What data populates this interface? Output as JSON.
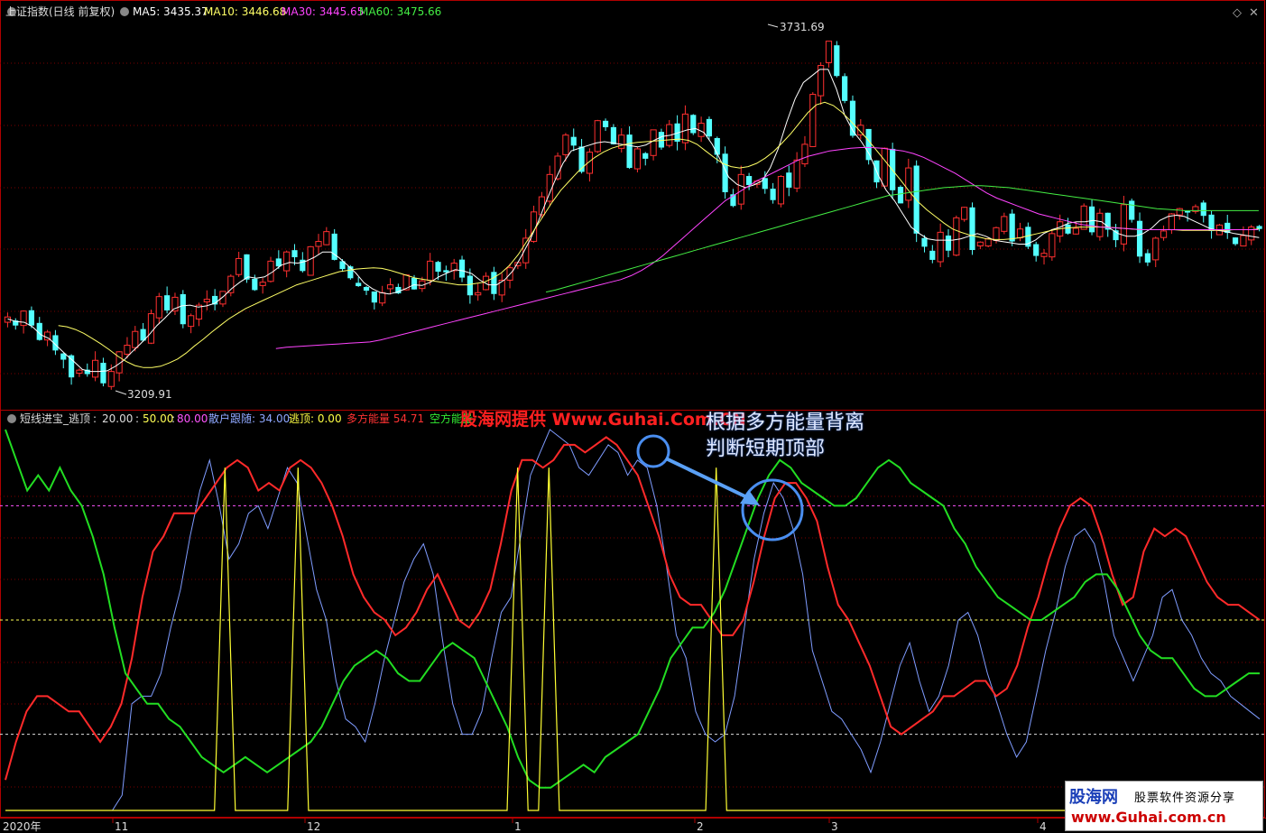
{
  "main": {
    "title": "上证指数(日线 前复权)",
    "ma5": {
      "label": "MA5: 3435.37",
      "color": "#ffffff"
    },
    "ma10": {
      "label": "MA10: 3446.68",
      "color": "#ffff66"
    },
    "ma30": {
      "label": "MA30: 3445.65",
      "color": "#ff44ff"
    },
    "ma60": {
      "label": "MA60: 3475.66",
      "color": "#44ee44"
    },
    "high_label": "3731.69",
    "low_label": "3209.91"
  },
  "indicator": {
    "name": "短线进宝_逃顶",
    "params": "20.00",
    "p2": "50.00",
    "p3": "80.00",
    "sanhu": "散户跟随: 34.00",
    "taoding": "逃顶: 0.00",
    "duofang": "多方能量  54.71",
    "kongfang": "空方能量 "
  },
  "overlay": {
    "credit": "股海网提供 Www.Guhai.Com.CN",
    "annotation_line1": "根据多方能量背离",
    "annotation_line2": "判断短期顶部"
  },
  "xaxis": [
    "2020年",
    "11",
    "12",
    "1",
    "2",
    "3",
    "4"
  ],
  "watermark": {
    "brand": "股海网",
    "tag": "股票软件资源分享",
    "url": "www.Guhai.com.cn"
  },
  "colors": {
    "up": "#ff3030",
    "down": "#54ffff",
    "border": "#b00000"
  },
  "chart_data": [
    {
      "type": "candlestick",
      "title": "上证指数(日线 前复权)",
      "x_ticks": [
        "2020年",
        "11",
        "12",
        "1",
        "2",
        "3",
        "4"
      ],
      "ylim": [
        3180,
        3760
      ],
      "high": 3731.69,
      "low": 3209.91,
      "close": [
        3313,
        3300,
        3322,
        3300,
        3278,
        3290,
        3262,
        3248,
        3221,
        3232,
        3226,
        3247,
        3212,
        3230,
        3260,
        3270,
        3291,
        3277,
        3318,
        3344,
        3323,
        3343,
        3302,
        3315,
        3331,
        3340,
        3332,
        3352,
        3375,
        3402,
        3370,
        3354,
        3366,
        3398,
        3390,
        3412,
        3404,
        3383,
        3420,
        3428,
        3443,
        3400,
        3386,
        3372,
        3360,
        3353,
        3335,
        3350,
        3362,
        3349,
        3377,
        3355,
        3368,
        3398,
        3382,
        3381,
        3395,
        3373,
        3346,
        3350,
        3375,
        3348,
        3369,
        3388,
        3396,
        3433,
        3473,
        3496,
        3530,
        3558,
        3590,
        3574,
        3534,
        3564,
        3612,
        3602,
        3576,
        3590,
        3540,
        3569,
        3554,
        3598,
        3571,
        3606,
        3580,
        3622,
        3593,
        3608,
        3588,
        3560,
        3503,
        3482,
        3530,
        3514,
        3520,
        3508,
        3491,
        3527,
        3510,
        3552,
        3576,
        3652,
        3696,
        3733,
        3680,
        3642,
        3589,
        3605,
        3552,
        3518,
        3570,
        3506,
        3486,
        3540,
        3440,
        3420,
        3400,
        3442,
        3414,
        3464,
        3480,
        3415,
        3427,
        3432,
        3449,
        3466,
        3428,
        3447,
        3420,
        3406,
        3410,
        3440,
        3458,
        3440,
        3448,
        3482,
        3442,
        3471,
        3446,
        3430,
        3484,
        3461,
        3405,
        3396,
        3433,
        3444,
        3470,
        3478,
        3472,
        3481,
        3467,
        3444,
        3453,
        3441,
        3424,
        3437,
        3450,
        3447
      ],
      "ma5": [
        3310,
        3306,
        3305,
        3298,
        3286,
        3280,
        3268,
        3256,
        3245,
        3233,
        3230,
        3230,
        3231,
        3238,
        3247,
        3260,
        3272,
        3285,
        3300,
        3312,
        3325,
        3330,
        3331,
        3328,
        3330,
        3334,
        3344,
        3356,
        3366,
        3374,
        3372,
        3374,
        3382,
        3392,
        3396,
        3395,
        3398,
        3404,
        3412,
        3412,
        3403,
        3392,
        3380,
        3365,
        3356,
        3350,
        3348,
        3351,
        3356,
        3362,
        3361,
        3366,
        3374,
        3380,
        3385,
        3383,
        3379,
        3369,
        3362,
        3362,
        3370,
        3384,
        3406,
        3430,
        3458,
        3490,
        3520,
        3547,
        3566,
        3570,
        3574,
        3578,
        3580,
        3578,
        3576,
        3574,
        3572,
        3575,
        3582,
        3588,
        3590,
        3594,
        3598,
        3600,
        3594,
        3576,
        3552,
        3526,
        3515,
        3510,
        3514,
        3520,
        3540,
        3570,
        3610,
        3645,
        3670,
        3680,
        3690,
        3690,
        3660,
        3620,
        3596,
        3580,
        3560,
        3530,
        3506,
        3490,
        3470,
        3450,
        3440,
        3432,
        3430,
        3430,
        3430,
        3432,
        3436,
        3440,
        3436,
        3430,
        3428,
        3426,
        3424,
        3424,
        3430,
        3440,
        3446,
        3450,
        3456,
        3458,
        3458,
        3460,
        3458,
        3448,
        3440,
        3436,
        3436,
        3440,
        3448,
        3460,
        3466,
        3468,
        3466,
        3460,
        3454,
        3448,
        3445,
        3443,
        3440,
        3438,
        3436,
        3434
      ],
      "ma10": [
        3300,
        3298,
        3294,
        3288,
        3280,
        3272,
        3263,
        3253,
        3245,
        3239,
        3236,
        3236,
        3238,
        3243,
        3249,
        3258,
        3269,
        3279,
        3290,
        3300,
        3310,
        3318,
        3326,
        3332,
        3338,
        3344,
        3350,
        3356,
        3362,
        3366,
        3370,
        3374,
        3378,
        3382,
        3384,
        3386,
        3387,
        3388,
        3387,
        3384,
        3380,
        3376,
        3372,
        3370,
        3368,
        3366,
        3364,
        3362,
        3362,
        3364,
        3366,
        3372,
        3380,
        3392,
        3408,
        3428,
        3448,
        3468,
        3488,
        3506,
        3520,
        3534,
        3546,
        3556,
        3564,
        3570,
        3574,
        3577,
        3579,
        3580,
        3581,
        3582,
        3583,
        3584,
        3582,
        3576,
        3566,
        3556,
        3547,
        3542,
        3540,
        3542,
        3547,
        3555,
        3565,
        3578,
        3592,
        3608,
        3624,
        3636,
        3640,
        3635,
        3625,
        3612,
        3598,
        3584,
        3568,
        3552,
        3536,
        3520,
        3503,
        3488,
        3476,
        3466,
        3456,
        3447,
        3442,
        3438,
        3435,
        3432,
        3431,
        3431,
        3432,
        3434,
        3437,
        3440,
        3443,
        3446,
        3448,
        3449,
        3450,
        3450,
        3450,
        3450,
        3449,
        3448,
        3447,
        3446,
        3446,
        3446,
        3446,
        3446,
        3445,
        3445,
        3445,
        3445,
        3445,
        3445,
        3446,
        3446,
        3446,
        3447
      ],
      "ma30": [
        3265,
        3267,
        3268,
        3269,
        3270,
        3271,
        3272,
        3273,
        3274,
        3275,
        3278,
        3282,
        3286,
        3290,
        3294,
        3298,
        3302,
        3306,
        3310,
        3314,
        3318,
        3322,
        3326,
        3330,
        3334,
        3338,
        3342,
        3346,
        3350,
        3354,
        3358,
        3362,
        3366,
        3370,
        3376,
        3384,
        3394,
        3406,
        3420,
        3434,
        3448,
        3462,
        3476,
        3490,
        3500,
        3510,
        3520,
        3528,
        3536,
        3544,
        3552,
        3558,
        3562,
        3566,
        3568,
        3570,
        3571,
        3571,
        3570,
        3568,
        3566,
        3562,
        3556,
        3548,
        3540,
        3532,
        3522,
        3512,
        3502,
        3494,
        3488,
        3482,
        3476,
        3470,
        3466,
        3462,
        3458,
        3454,
        3452,
        3450,
        3449,
        3448,
        3447,
        3446,
        3446,
        3446,
        3446,
        3446,
        3446,
        3446,
        3446,
        3446,
        3446,
        3446,
        3446
      ],
      "ma60": [
        3351,
        3354,
        3358,
        3362,
        3366,
        3370,
        3374,
        3378,
        3382,
        3386,
        3390,
        3394,
        3398,
        3402,
        3406,
        3410,
        3414,
        3418,
        3422,
        3426,
        3430,
        3434,
        3438,
        3442,
        3446,
        3450,
        3454,
        3458,
        3462,
        3466,
        3470,
        3474,
        3478,
        3482,
        3486,
        3490,
        3494,
        3498,
        3500,
        3502,
        3504,
        3506,
        3508,
        3510,
        3511,
        3512,
        3513,
        3513,
        3512,
        3511,
        3510,
        3508,
        3506,
        3504,
        3502,
        3500,
        3498,
        3496,
        3494,
        3492,
        3490,
        3488,
        3486,
        3484,
        3482,
        3480,
        3478,
        3477,
        3476,
        3475,
        3475,
        3475,
        3475,
        3475,
        3475,
        3475,
        3475,
        3475
      ]
    },
    {
      "type": "line",
      "title": "短线进宝_逃顶",
      "ylim": [
        0,
        100
      ],
      "reference_lines": [
        20,
        50,
        80
      ],
      "series": [
        {
          "name": "散户跟随",
          "color": "#7f9cff",
          "values": [
            0,
            0,
            0,
            0,
            0,
            0,
            0,
            0,
            0,
            0,
            0,
            0,
            4,
            28,
            30,
            30,
            36,
            48,
            58,
            72,
            84,
            92,
            80,
            66,
            70,
            78,
            80,
            74,
            82,
            90,
            86,
            72,
            58,
            50,
            34,
            24,
            22,
            18,
            28,
            40,
            50,
            60,
            66,
            70,
            62,
            44,
            28,
            20,
            20,
            26,
            40,
            52,
            56,
            72,
            88,
            94,
            100,
            98,
            96,
            90,
            88,
            92,
            96,
            94,
            88,
            92,
            90,
            80,
            64,
            46,
            40,
            26,
            20,
            18,
            20,
            30,
            48,
            66,
            78,
            86,
            82,
            74,
            62,
            42,
            34,
            26,
            24,
            20,
            16,
            10,
            18,
            28,
            38,
            44,
            34,
            26,
            30,
            38,
            50,
            52,
            46,
            36,
            28,
            20,
            14,
            18,
            30,
            42,
            52,
            64,
            72,
            74,
            70,
            60,
            46,
            40,
            34,
            40,
            46,
            56,
            58,
            50,
            46,
            40,
            36,
            34,
            30,
            28,
            26,
            24
          ]
        },
        {
          "name": "多方能量",
          "color": "#ff2a2a",
          "values": [
            8,
            18,
            26,
            30,
            30,
            28,
            26,
            26,
            22,
            18,
            22,
            28,
            40,
            56,
            68,
            72,
            78,
            78,
            78,
            82,
            86,
            90,
            92,
            90,
            84,
            86,
            84,
            90,
            92,
            90,
            86,
            80,
            72,
            62,
            56,
            52,
            50,
            46,
            48,
            52,
            58,
            62,
            56,
            50,
            48,
            52,
            58,
            70,
            84,
            92,
            92,
            90,
            92,
            96,
            96,
            94,
            96,
            98,
            96,
            92,
            88,
            80,
            72,
            62,
            56,
            54,
            54,
            50,
            46,
            46,
            50,
            60,
            72,
            82,
            86,
            86,
            82,
            76,
            64,
            54,
            50,
            44,
            38,
            30,
            22,
            20,
            22,
            24,
            26,
            30,
            30,
            32,
            34,
            34,
            30,
            32,
            38,
            48,
            56,
            66,
            74,
            80,
            82,
            80,
            72,
            62,
            54,
            56,
            68,
            74,
            72,
            74,
            72,
            66,
            60,
            56,
            54,
            54,
            52,
            50
          ]
        },
        {
          "name": "空方能量",
          "color": "#22dd22",
          "values": [
            100,
            92,
            84,
            88,
            84,
            90,
            84,
            80,
            72,
            62,
            48,
            36,
            32,
            28,
            28,
            24,
            22,
            18,
            14,
            12,
            10,
            12,
            14,
            12,
            10,
            12,
            14,
            16,
            18,
            22,
            28,
            34,
            38,
            40,
            42,
            40,
            36,
            34,
            34,
            38,
            42,
            44,
            42,
            40,
            34,
            28,
            22,
            14,
            8,
            6,
            6,
            8,
            10,
            12,
            10,
            14,
            16,
            18,
            20,
            26,
            32,
            40,
            44,
            48,
            48,
            52,
            58,
            66,
            74,
            82,
            88,
            92,
            90,
            86,
            84,
            82,
            80,
            80,
            82,
            86,
            90,
            92,
            90,
            86,
            84,
            82,
            80,
            74,
            70,
            64,
            60,
            56,
            54,
            52,
            50,
            50,
            52,
            54,
            56,
            60,
            62,
            62,
            58,
            52,
            46,
            42,
            40,
            40,
            36,
            32,
            30,
            30,
            32,
            34,
            36,
            36
          ]
        },
        {
          "name": "逃顶",
          "color": "#ffff33",
          "values": [
            0,
            0,
            0,
            0,
            0,
            0,
            0,
            0,
            0,
            0,
            0,
            0,
            0,
            0,
            0,
            0,
            0,
            0,
            0,
            0,
            0,
            90,
            0,
            0,
            0,
            0,
            0,
            0,
            90,
            0,
            0,
            0,
            0,
            0,
            0,
            0,
            0,
            0,
            0,
            0,
            0,
            0,
            0,
            0,
            0,
            0,
            0,
            0,
            0,
            90,
            0,
            0,
            90,
            0,
            0,
            0,
            0,
            0,
            0,
            0,
            0,
            0,
            0,
            0,
            0,
            0,
            0,
            0,
            90,
            0,
            0,
            0,
            0,
            0,
            0,
            0,
            0,
            0,
            0,
            0,
            0,
            0,
            0,
            0,
            0,
            0,
            0,
            0,
            0,
            0,
            0,
            0,
            0,
            0,
            0,
            0,
            0,
            0,
            0,
            0,
            0,
            0,
            0,
            0,
            0,
            0,
            0,
            0,
            0,
            0,
            0,
            0,
            0,
            0,
            0,
            0,
            0,
            0,
            0,
            0,
            0
          ]
        }
      ]
    }
  ]
}
